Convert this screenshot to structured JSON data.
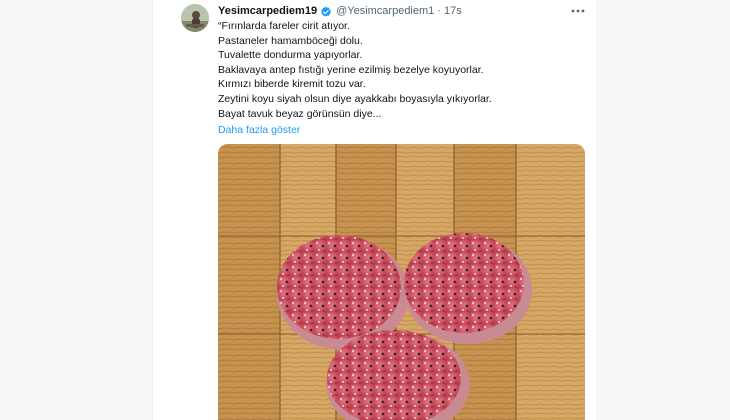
{
  "tweet": {
    "display_name": "Yesimcarpediem19",
    "handle": "@Yesimcarpediem1",
    "separator": "·",
    "time": "17s",
    "lines": [
      "“Fırınlarda fareler cirit atıyor.",
      "Pastaneler hamamböceği dolu.",
      "Tuvalette dondurma yapıyorlar.",
      "Baklavaya antep fıstığı yerine ezilmiş bezelye koyuyorlar.",
      "Kırmızı biberde kiremit tozu var.",
      "Zeytini koyu siyah olsun diye ayakkabı boyasıyla yıkıyorlar.",
      "Bayat tavuk beyaz görünsün diye..."
    ],
    "show_more": "Daha fazla göster"
  },
  "icons": {
    "verified": "verified-badge-icon",
    "more": "more-options-icon"
  },
  "colors": {
    "link": "#1d9bf0",
    "secondary_text": "#536471",
    "primary_text": "#0f1419",
    "gutter": "#f7f9f9"
  }
}
